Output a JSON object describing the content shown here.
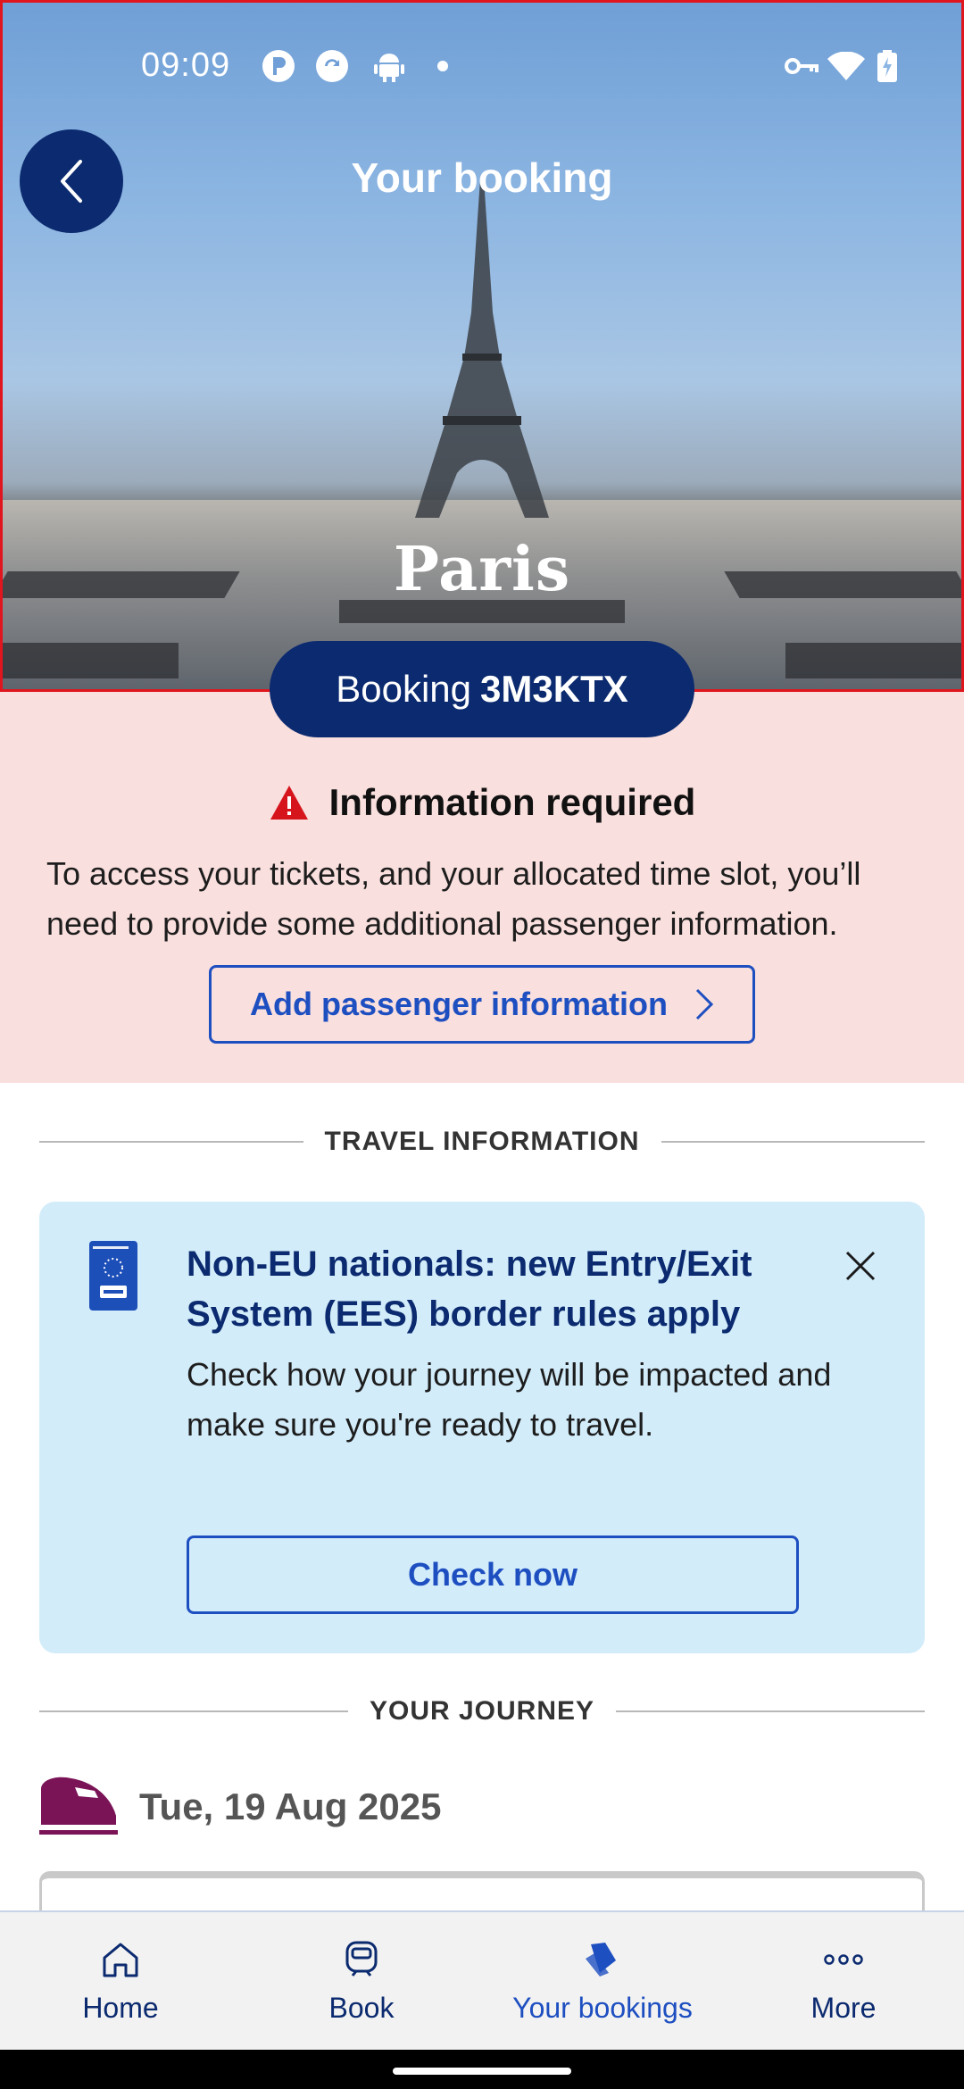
{
  "status_bar": {
    "time": "09:09"
  },
  "header": {
    "title": "Your booking",
    "city": "Paris"
  },
  "booking": {
    "prefix": "Booking",
    "reference": "3M3KTX"
  },
  "alert": {
    "title": "Information required",
    "text": "To access your tickets, and your allocated time slot, you’ll need to provide some additional passenger information.",
    "button_label": "Add passenger information"
  },
  "travel_section": {
    "label": "TRAVEL INFORMATION"
  },
  "ees_card": {
    "title": "Non-EU nationals: new Entry/Exit System (EES) border rules apply",
    "text": "Check how your journey will be impacted and make sure you're ready to travel.",
    "button_label": "Check now",
    "icon": "passport-icon"
  },
  "journey_section": {
    "label": "YOUR JOURNEY",
    "date": "Tue, 19 Aug 2025"
  },
  "nav": {
    "items": [
      {
        "label": "Home",
        "icon": "home-icon"
      },
      {
        "label": "Book",
        "icon": "train-icon"
      },
      {
        "label": "Your bookings",
        "icon": "tickets-icon",
        "active": true
      },
      {
        "label": "More",
        "icon": "more-icon"
      }
    ]
  },
  "colors": {
    "navy": "#0b2a6f",
    "link_blue": "#1e4fc1",
    "alert_bg": "#f9dfdd",
    "card_bg": "#d2ecfa",
    "warning_red": "#d6141c",
    "train_purple": "#7a1457"
  }
}
